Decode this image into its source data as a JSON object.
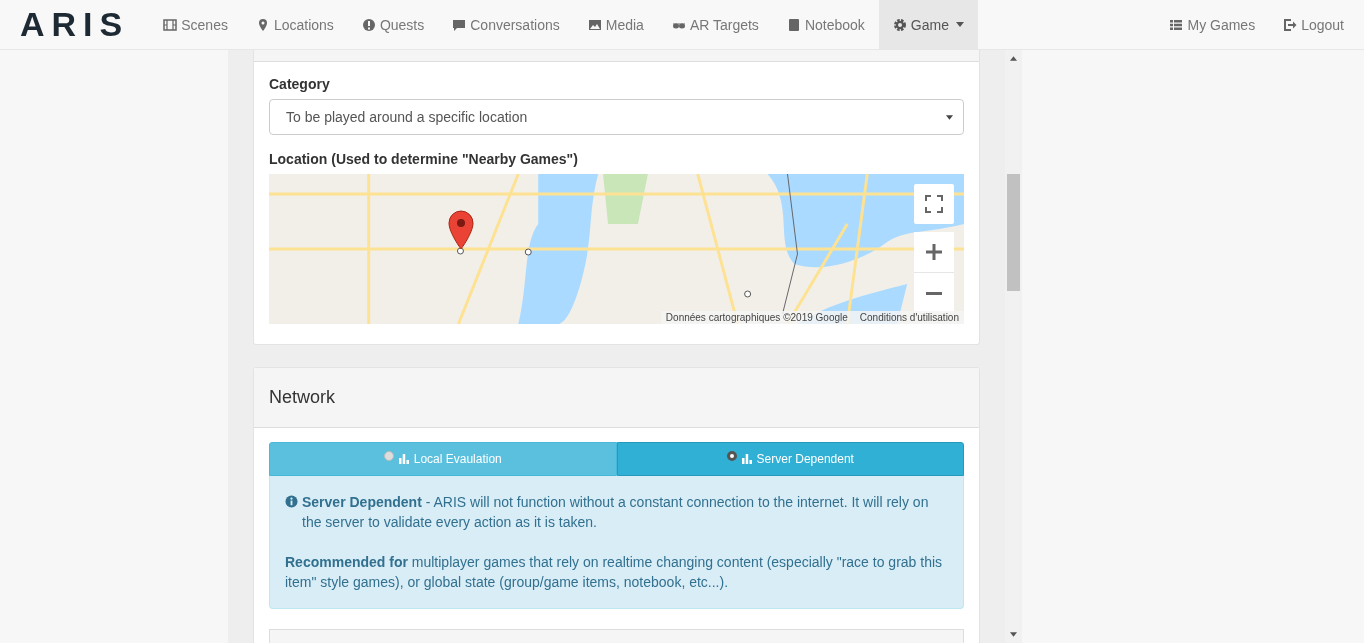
{
  "navbar": {
    "brand": "ARIS",
    "items": [
      {
        "label": "Scenes",
        "selected": false
      },
      {
        "label": "Locations",
        "selected": false
      },
      {
        "label": "Quests",
        "selected": false
      },
      {
        "label": "Conversations",
        "selected": false
      },
      {
        "label": "Media",
        "selected": false
      },
      {
        "label": "AR Targets",
        "selected": false
      },
      {
        "label": "Notebook",
        "selected": false
      },
      {
        "label": "Game",
        "selected": true,
        "dropdown": true
      }
    ],
    "right_items": [
      {
        "label": "My Games"
      },
      {
        "label": "Logout"
      }
    ]
  },
  "location_card": {
    "category_label": "Category",
    "category_value": "To be played around a specific location",
    "location_label": "Location (Used to determine \"Nearby Games\")",
    "map": {
      "attribution": "Données cartographiques ©2019 Google",
      "terms_link": "Conditions d'utilisation"
    }
  },
  "network_card": {
    "title": "Network",
    "options": [
      {
        "label": "Local Evaulation",
        "selected": false
      },
      {
        "label": "Server Dependent",
        "selected": true
      }
    ],
    "info": [
      "**Server Dependent** - ARIS will not function without a constant connection to the internet. It will rely on the server to validate every action as it is taken.",
      "**Recommended for** multiplayer games that rely on realtime changing content (especially \"race to grab this item\" style games), or global state (group/game items, notebook, etc...)."
    ]
  }
}
